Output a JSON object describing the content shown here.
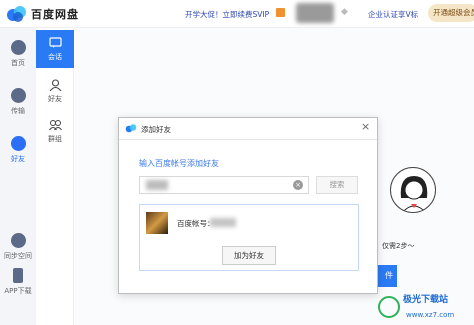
{
  "header": {
    "brand": "百度网盘",
    "promo": "开学大促！立即续费SVIP",
    "cert": "企业认证享V标",
    "open_button": "开通超级会员"
  },
  "sidebar": {
    "items": [
      {
        "label": "首页",
        "icon": "cloud-icon"
      },
      {
        "label": "传输",
        "icon": "transfer-icon"
      },
      {
        "label": "好友",
        "icon": "friends-icon",
        "active": true
      },
      {
        "label": "同步空间",
        "icon": "sync-icon"
      },
      {
        "label": "APP下载",
        "icon": "phone-icon"
      }
    ]
  },
  "subnav": {
    "items": [
      {
        "label": "会话",
        "active": true
      },
      {
        "label": "好友"
      },
      {
        "label": "群组"
      }
    ]
  },
  "main": {
    "tip": "仅需2步～",
    "action_fragment": "件"
  },
  "dialog": {
    "title": "添加好友",
    "close": "×",
    "prompt": "输入百度帐号添加好友",
    "search_button": "搜索",
    "result_label": "百度帐号：",
    "add_button": "加为好友"
  },
  "watermark": {
    "title": "极光下载站",
    "url": "www.xz7.com"
  },
  "colors": {
    "accent": "#2a7af3",
    "link": "#2c46b4",
    "sidebar_bg": "#f3f5f9"
  }
}
